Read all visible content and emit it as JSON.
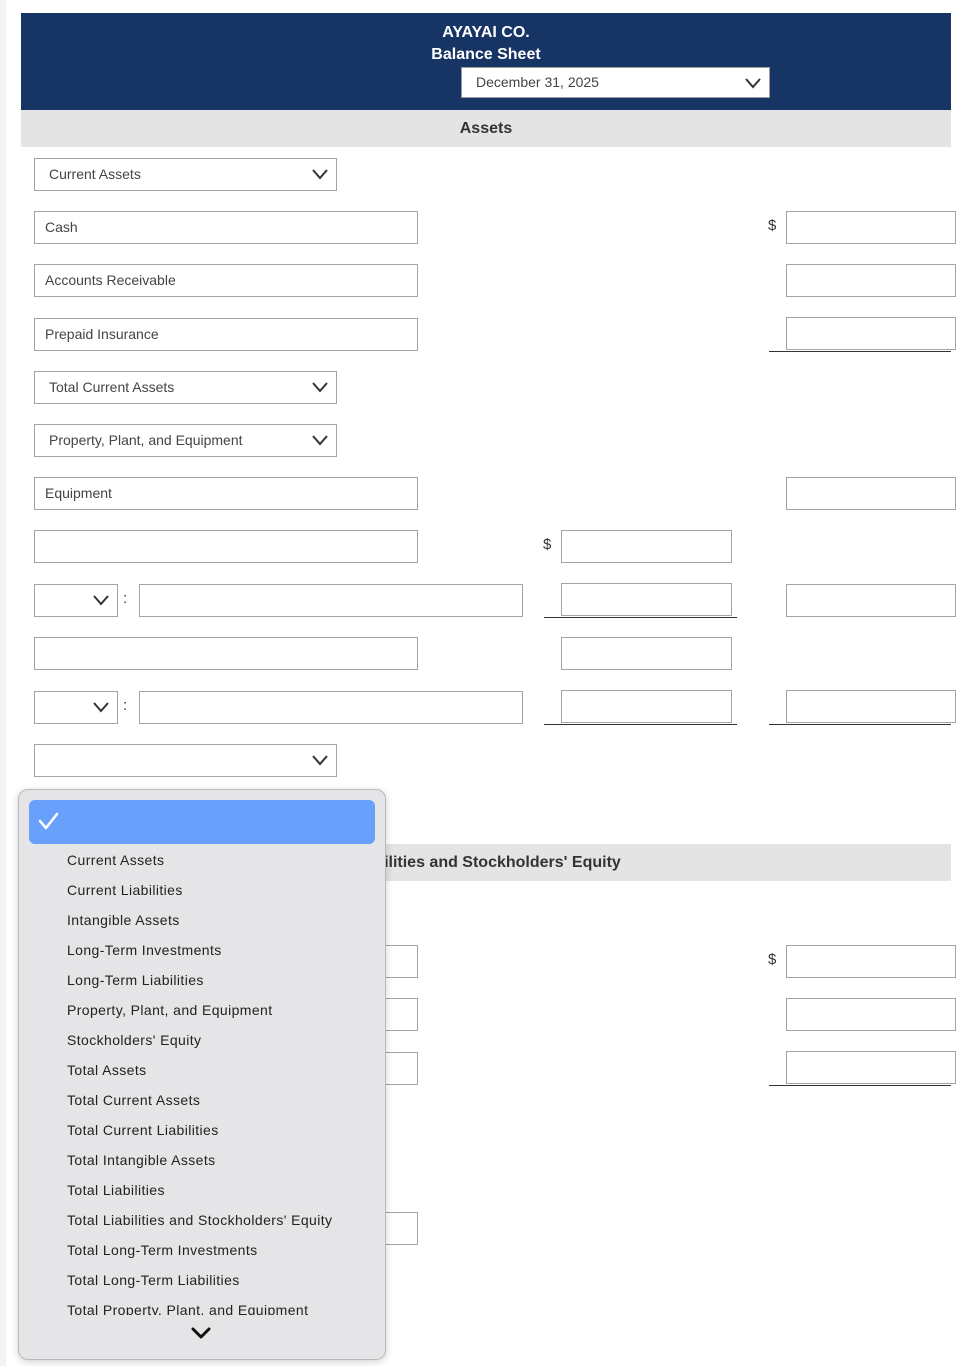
{
  "header": {
    "company": "AYAYAI CO.",
    "title": "Balance Sheet",
    "date_value": "December 31, 2025"
  },
  "sections": {
    "assets": "Assets",
    "liabilities_equity": "Liabilities and Stockholders' Equity"
  },
  "assets_rows": {
    "current_assets_select": "Current Assets",
    "cash": "Cash",
    "accounts_receivable": "Accounts Receivable",
    "prepaid_insurance": "Prepaid Insurance",
    "total_current_assets_select": "Total Current Assets",
    "ppe_select": "Property, Plant, and Equipment",
    "equipment": "Equipment",
    "blank_text_1": "",
    "blank_select_1": "",
    "blank_text_2": "",
    "blank_text_3": "",
    "blank_select_2": "",
    "blank_text_4": "",
    "blank_select_3": ""
  },
  "symbols": {
    "dollar": "$",
    "colon": ":"
  },
  "dropdown": {
    "selected_label": "",
    "items": [
      "Current Assets",
      "Current Liabilities",
      "Intangible Assets",
      "Long-Term Investments",
      "Long-Term Liabilities",
      "Property, Plant, and Equipment",
      "Stockholders' Equity",
      "Total Assets",
      "Total Current Assets",
      "Total Current Liabilities",
      "Total Intangible Assets",
      "Total Liabilities",
      "Total Liabilities and Stockholders' Equity",
      "Total Long-Term Investments",
      "Total Long-Term Liabilities",
      "Total Property, Plant, and Equipment"
    ]
  }
}
